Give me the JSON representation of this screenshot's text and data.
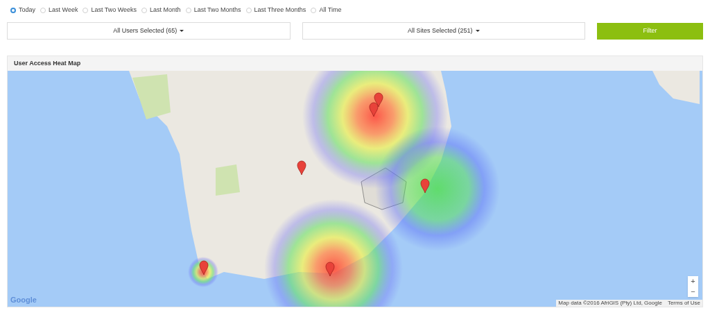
{
  "periods": [
    {
      "label": "Today",
      "selected": true
    },
    {
      "label": "Last Week",
      "selected": false
    },
    {
      "label": "Last Two Weeks",
      "selected": false
    },
    {
      "label": "Last Month",
      "selected": false
    },
    {
      "label": "Last Two Months",
      "selected": false
    },
    {
      "label": "Last Three Months",
      "selected": false
    },
    {
      "label": "All Time",
      "selected": false
    }
  ],
  "filters": {
    "users": "All Users Selected (65)",
    "sites": "All Sites Selected (251)",
    "button": "Filter"
  },
  "panel": {
    "title": "User Access Heat Map",
    "map": {
      "logo": "Google",
      "zoom_in": "+",
      "zoom_out": "−",
      "attribution": "Map data ©2016 AfriGIS (Pty) Ltd, Google",
      "terms": "Terms of Use"
    }
  }
}
